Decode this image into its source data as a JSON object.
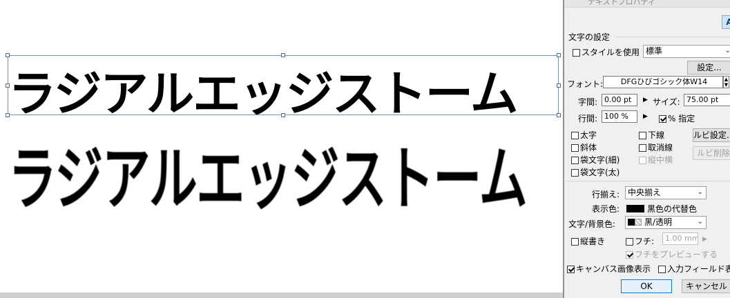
{
  "canvas": {
    "line1": "ラジアルエッジストーム",
    "line2": "ラジアルエッジストーム"
  },
  "panel": {
    "title": "テキストプロパティ",
    "tool_icon": "A",
    "section_text_settings": "文字の設定",
    "use_style_label": "スタイルを使用",
    "style_select": "標準",
    "settings_button": "設定...",
    "font_label": "フォント:",
    "font_value": "DFGひびゴシック体W14",
    "char_spacing_label": "字間:",
    "char_spacing_value": "0.00 pt",
    "size_label": "サイズ:",
    "size_value": "75.00 pt",
    "line_spacing_label": "行間:",
    "line_spacing_value": "100 %",
    "percent_specify_label": "% 指定",
    "bold_label": "太字",
    "italic_label": "斜体",
    "outline_thin_label": "袋文字(細)",
    "outline_thick_label": "袋文字(太)",
    "underline_label": "下線",
    "strikethrough_label": "取消線",
    "tate_chu_yoko_label": "縦中横",
    "ruby_settings_button": "ルビ設定...",
    "ruby_delete_button": "ルビ削除",
    "align_label": "行揃え:",
    "align_value": "中央揃え",
    "display_color_label": "表示色:",
    "display_color_value": "黒色の代替色",
    "text_bg_color_label": "文字/背景色:",
    "text_bg_color_value": "黒/透明",
    "vertical_label": "縦書き",
    "border_label": "フチ:",
    "border_value": "1.00 mm",
    "border_preview_label": "フチをプレビューする",
    "canvas_image_label": "キャンバス画像表示",
    "input_field_label": "入力フィールド表示",
    "ok_button": "OK",
    "cancel_button": "キャンセル"
  },
  "colors": {
    "accent": "#0078d7",
    "selection": "#7a8ea6"
  }
}
